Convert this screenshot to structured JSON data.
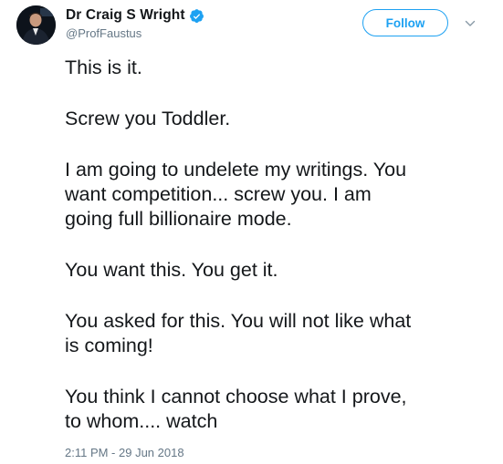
{
  "author": {
    "display_name": "Dr Craig S Wright",
    "handle": "@ProfFaustus",
    "verified_icon": "verified-badge-icon"
  },
  "actions": {
    "follow_label": "Follow",
    "more_icon": "chevron-down-icon"
  },
  "tweet": {
    "paragraphs": [
      "This is it.",
      "Screw you Toddler.",
      "I am going to undelete my writings. You\nwant competition... screw you. I am\ngoing full billionaire mode.",
      "You want this. You get it.",
      "You asked for this. You will not like what\nis coming!",
      "You think I cannot choose what I prove,\nto whom.... watch"
    ],
    "timestamp": "2:11 PM - 29 Jun 2018"
  },
  "colors": {
    "accent": "#1da1f2",
    "text": "#14171a",
    "secondary_text": "#657786"
  }
}
